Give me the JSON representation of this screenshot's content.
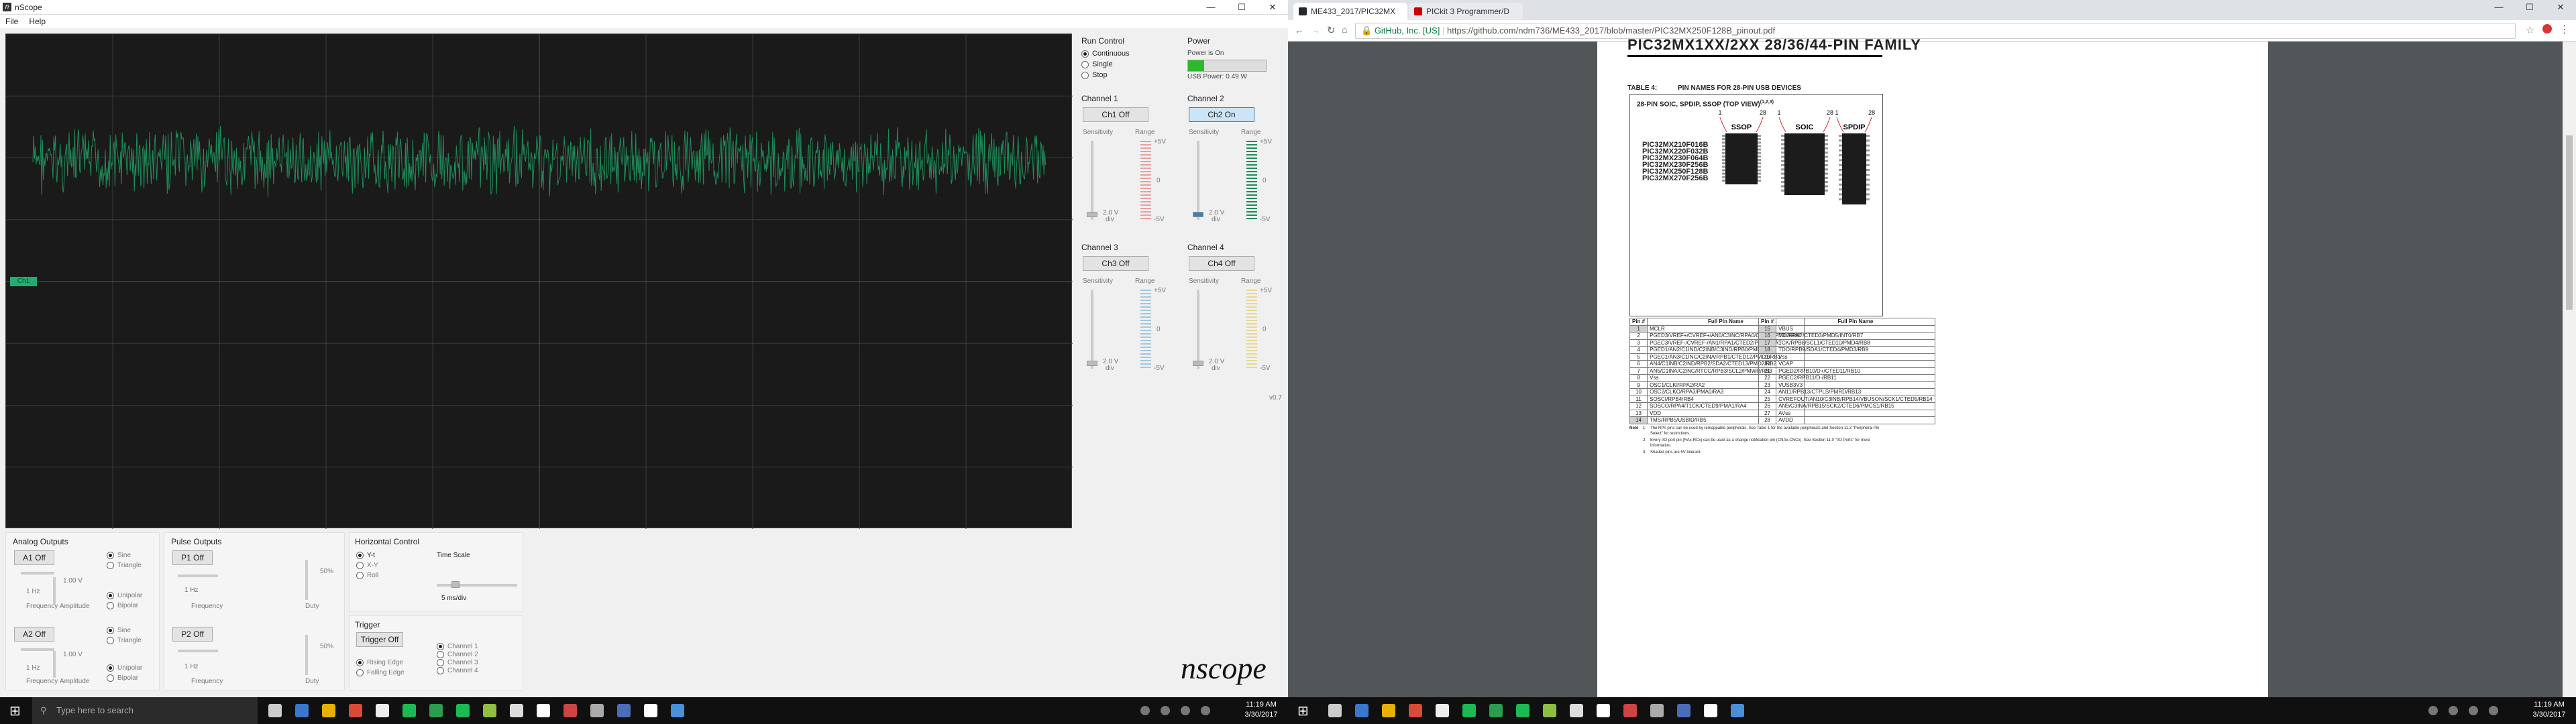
{
  "nscope": {
    "window_title": "nScope",
    "menu": [
      "File",
      "Help"
    ],
    "channel_marker": "Ch1",
    "run_control": {
      "title": "Run Control",
      "options": [
        "Continuous",
        "Single",
        "Stop"
      ],
      "selected": 0
    },
    "power": {
      "title": "Power",
      "status": "Power is On",
      "usb": "USB Power: 0.49 W",
      "color": "#2eb82e"
    },
    "channels": [
      {
        "title": "Channel 1",
        "button": "Ch1 Off",
        "on": false,
        "color": "#e8a0a0",
        "volts": "2.0 V",
        "div": "div",
        "range_top": "+5V",
        "range_mid": "0",
        "range_bot": "-5V"
      },
      {
        "title": "Channel 2",
        "button": "Ch2 On",
        "on": true,
        "color": "#1e8c5a",
        "volts": "2.0 V",
        "div": "div",
        "range_top": "+5V",
        "range_mid": "0",
        "range_bot": "-5V"
      },
      {
        "title": "Channel 3",
        "button": "Ch3 Off",
        "on": false,
        "color": "#a0c8e0",
        "volts": "2.0 V",
        "div": "div",
        "range_top": "+5V",
        "range_mid": "0",
        "range_bot": "-5V"
      },
      {
        "title": "Channel 4",
        "button": "Ch4 Off",
        "on": false,
        "color": "#e8d890",
        "volts": "2.0 V",
        "div": "div",
        "range_top": "+5V",
        "range_mid": "0",
        "range_bot": "-5V"
      }
    ],
    "sensitivity_label": "Sensitivity",
    "range_label": "Range",
    "version": "v0.7",
    "analog_outputs": {
      "title": "Analog Outputs",
      "a1": {
        "button": "A1 Off",
        "waves": [
          "Sine",
          "Triangle"
        ],
        "polarity": [
          "Unipolar",
          "Bipolar"
        ],
        "freq_val": "1 Hz",
        "freq_label": "Frequency",
        "amp_val": "1.00 V",
        "amp_label": "Amplitude"
      },
      "a2": {
        "button": "A2 Off",
        "waves": [
          "Sine",
          "Triangle"
        ],
        "polarity": [
          "Unipolar",
          "Bipolar"
        ],
        "freq_val": "1 Hz",
        "freq_label": "Frequency",
        "amp_val": "1.00 V",
        "amp_label": "Amplitude"
      }
    },
    "pulse_outputs": {
      "title": "Pulse Outputs",
      "p1": {
        "button": "P1 Off",
        "freq_val": "1 Hz",
        "freq_label": "Frequency",
        "duty_val": "50%",
        "duty_label": "Duty"
      },
      "p2": {
        "button": "P2 Off",
        "freq_val": "1 Hz",
        "freq_label": "Frequency",
        "duty_val": "50%",
        "duty_label": "Duty"
      }
    },
    "horizontal": {
      "title": "Horizontal Control",
      "options": [
        "Y-t",
        "X-Y",
        "Roll"
      ],
      "timescale_label": "Time Scale",
      "timescale": "5 ms/div"
    },
    "trigger": {
      "title": "Trigger",
      "button": "Trigger Off",
      "edges": [
        "Rising Edge",
        "Falling Edge"
      ],
      "channels": [
        "Channel 1",
        "Channel 2",
        "Channel 3",
        "Channel 4"
      ]
    },
    "logo": "nscope"
  },
  "browser": {
    "tabs": [
      "ME433_2017/PIC32MX",
      "PICkit 3 Programmer/D"
    ],
    "address_secure": "GitHub, Inc. [US]",
    "address_url": "https://github.com/ndm736/ME433_2017/blob/master/PIC32MX250F128B_pinout.pdf"
  },
  "pdf": {
    "family_title": "PIC32MX1XX/2XX 28/36/44-PIN FAMILY",
    "table_title": "TABLE 4:",
    "table_name": "PIN NAMES FOR 28-PIN USB DEVICES",
    "package_title": "28-PIN SOIC, SPDIP, SSOP (TOP VIEW)",
    "package_sup": "(1,2,3)",
    "packages": [
      "SSOP",
      "SOIC",
      "SPDIP"
    ],
    "pin_one": "1",
    "pin_last": "28",
    "part_numbers": [
      "PIC32MX210F016B",
      "PIC32MX220F032B",
      "PIC32MX230F064B",
      "PIC32MX230F256B",
      "PIC32MX250F128B",
      "PIC32MX270F256B"
    ],
    "col_pin": "Pin #",
    "col_name": "Full Pin Name",
    "left_pins": [
      {
        "n": "1",
        "name": "MCLR",
        "shade": true
      },
      {
        "n": "2",
        "name": "PGED3/VREF+/CVREF+/AN0/C3INC/RPA0/CTED1/PMD7/RA0",
        "shade": false
      },
      {
        "n": "3",
        "name": "PGEC3/VREF-/CVREF-/AN1/RPA1/CTED2/PMD6/RA1",
        "shade": false
      },
      {
        "n": "4",
        "name": "PGED1/AN2/C1IND/C2INB/C3IND/RPB0/PMD0/RB0",
        "shade": false
      },
      {
        "n": "5",
        "name": "PGEC1/AN3/C1INC/C2INA/RPB1/CTED12/PMD1/RB1",
        "shade": false
      },
      {
        "n": "6",
        "name": "AN4/C1INB/C2IND/RPB2/SDA2/CTED13/PMD2/RB2",
        "shade": false
      },
      {
        "n": "7",
        "name": "AN5/C1INA/C2INC/RTCC/RPB3/SCL2/PMWR/RB3",
        "shade": false
      },
      {
        "n": "8",
        "name": "Vss",
        "shade": false
      },
      {
        "n": "9",
        "name": "OSC1/CLKI/RPA2/RA2",
        "shade": false
      },
      {
        "n": "10",
        "name": "OSC2/CLKO/RPA3/PMA0/RA3",
        "shade": false
      },
      {
        "n": "11",
        "name": "SOSCI/RPB4/RB4",
        "shade": false
      },
      {
        "n": "12",
        "name": "SOSCO/RPA4/T1CK/CTED9/PMA1/RA4",
        "shade": false
      },
      {
        "n": "13",
        "name": "VDD",
        "shade": false
      },
      {
        "n": "14",
        "name": "TMS/RPB5/USBID/RB5",
        "shade": true
      }
    ],
    "right_pins": [
      {
        "n": "15",
        "name": "VBUS",
        "shade": true
      },
      {
        "n": "16",
        "name": "TDI/RPB7/CTED3/PMD5/INT0/RB7",
        "shade": true
      },
      {
        "n": "17",
        "name": "TCK/RPB8/SCL1/CTED10/PMD4/RB8",
        "shade": true
      },
      {
        "n": "18",
        "name": "TDO/RPB9/SDA1/CTED4/PMD3/RB9",
        "shade": true
      },
      {
        "n": "19",
        "name": "Vss",
        "shade": false
      },
      {
        "n": "20",
        "name": "VCAP",
        "shade": false
      },
      {
        "n": "21",
        "name": "PGED2/RPB10/D+/CTED11/RB10",
        "shade": false
      },
      {
        "n": "22",
        "name": "PGEC2/RPB11/D-/RB11",
        "shade": false
      },
      {
        "n": "23",
        "name": "VUSB3V3",
        "shade": false
      },
      {
        "n": "24",
        "name": "AN11/RPB13/CTPLS/PMRD/RB13",
        "shade": false
      },
      {
        "n": "25",
        "name": "CVREFOUT/AN10/C3INB/RPB14/VBUSON/SCK1/CTED5/RB14",
        "shade": false
      },
      {
        "n": "26",
        "name": "AN9/C3INA/RPB15/SCK2/CTED6/PMCS1/RB15",
        "shade": false
      },
      {
        "n": "27",
        "name": "AVss",
        "shade": false
      },
      {
        "n": "28",
        "name": "AVDD",
        "shade": false
      }
    ],
    "note_label": "Note",
    "notes": [
      {
        "n": "1:",
        "text": "The RPn pins can be used by remappable peripherals. See Table 1 for the available peripherals and Section 11.3 \"Peripheral Pin Select\" for restrictions."
      },
      {
        "n": "2:",
        "text": "Every I/O port pin (RAx-RCx) can be used as a change notification pin (CNAx-CNCx). See Section 11.0 \"I/O Ports\" for more information."
      },
      {
        "n": "3:",
        "text": "Shaded pins are 5V tolerant."
      }
    ]
  },
  "taskbar": {
    "search_placeholder": "Type here to search",
    "time": "11:19 AM",
    "date": "3/30/2017"
  }
}
